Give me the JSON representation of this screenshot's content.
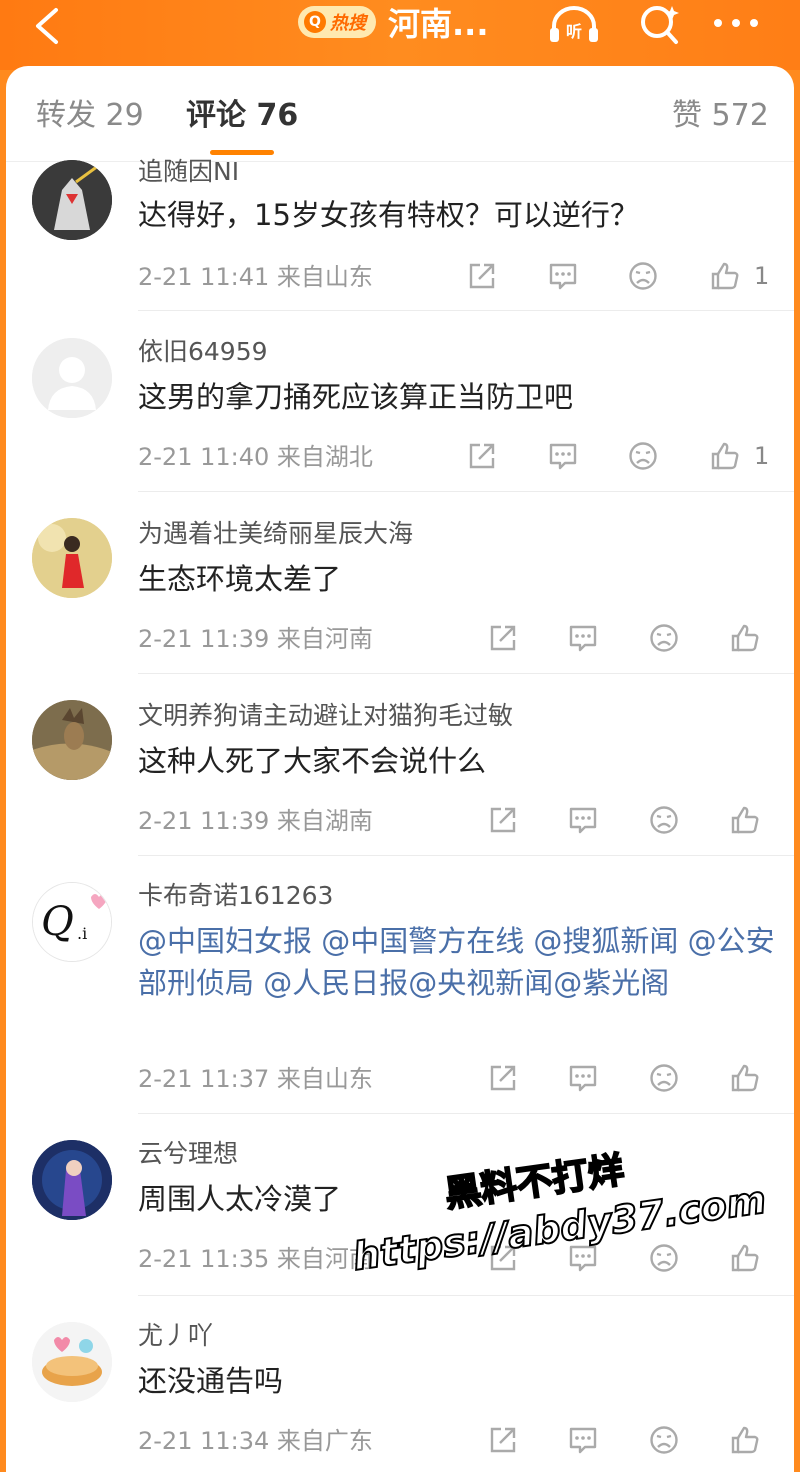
{
  "header": {
    "hot_search_label": "热搜",
    "topic_title": "河南...",
    "listen_label": "听"
  },
  "tabs": {
    "repost": "转发 29",
    "comment": "评论 76",
    "like": "赞 572"
  },
  "comments": [
    {
      "username": "追随因NI",
      "text": "达得好，15岁女孩有特权？可以逆行？",
      "time": "2-21 11:41",
      "location": "来自山东",
      "likes": "1"
    },
    {
      "username": "依旧64959",
      "text": "这男的拿刀捅死应该算正当防卫吧",
      "time": "2-21 11:40",
      "location": "来自湖北",
      "likes": "1"
    },
    {
      "username": "为遇着壮美绮丽星辰大海",
      "text": "生态环境太差了",
      "time": "2-21 11:39",
      "location": "来自河南",
      "likes": ""
    },
    {
      "username": "文明养狗请主动避让对猫狗毛过敏",
      "text": "这种人死了大家不会说什么",
      "time": "2-21 11:39",
      "location": "来自湖南",
      "likes": ""
    },
    {
      "username": "卡布奇诺161263",
      "text": "@中国妇女报 @中国警方在线 @搜狐新闻 @公安部刑侦局 @人民日报@央视新闻@紫光阁",
      "time": "2-21 11:37",
      "location": "来自山东",
      "likes": ""
    },
    {
      "username": "云兮理想",
      "text": "周围人太冷漠了",
      "time": "2-21 11:35",
      "location": "来自河南",
      "likes": ""
    },
    {
      "username": "尤丿吖",
      "text": "还没通告吗",
      "time": "2-21 11:34",
      "location": "来自广东",
      "likes": ""
    }
  ],
  "watermark": {
    "line1": "黑料不打烊",
    "line2": "https://abdy37.com"
  },
  "colors": {
    "brand_orange": "#ff8200",
    "mention_blue": "#4a6fa8"
  }
}
